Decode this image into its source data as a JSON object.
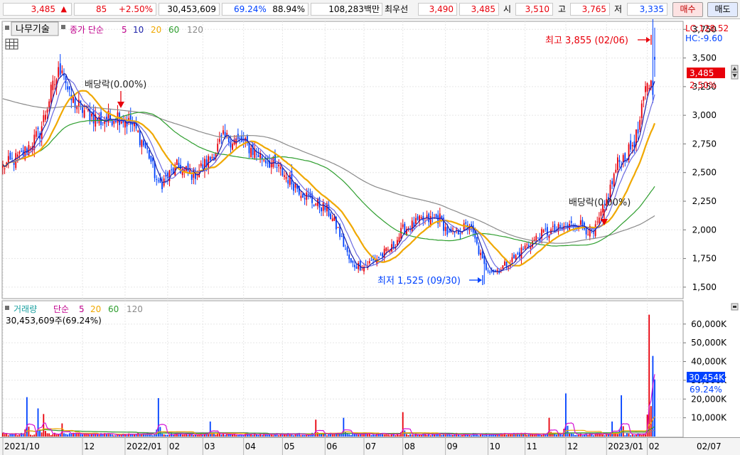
{
  "quote": {
    "price": "3,485",
    "change": "85",
    "change_pct": "+2.50%",
    "volume": "30,453,609",
    "vol_ratio": "69.24%",
    "turnover_ratio": "88.94%",
    "amount": "108,283백만",
    "best_label": "최우선",
    "ask": "3,490",
    "bid": "3,485",
    "open_label": "시",
    "open": "3,510",
    "high_label": "고",
    "high": "3,765",
    "low_label": "저",
    "low": "3,335",
    "buy_btn": "매수",
    "sell_btn": "매도"
  },
  "price_panel": {
    "tech_btn": "나무기술",
    "legend_prefix": "종가 단순",
    "ma_labels": [
      "5",
      "10",
      "20",
      "60",
      "120"
    ],
    "lc_label": "LC:128.52",
    "hc_label": "HC:-9.60",
    "last_price_label": "3,485",
    "last_change_label": "2.50%",
    "max_label": "최고 3,855 (02/06)",
    "min_label": "최저 1,525 (09/30)",
    "dividend_label": "배당락(0.00%)"
  },
  "volume_panel": {
    "legend_name": "거래량",
    "legend_prefix": "단순",
    "ma_labels": [
      "5",
      "20",
      "60",
      "120"
    ],
    "info_label": "30,453,609주(69.24%)",
    "last_volume_label": "30,454K",
    "last_pct_label": "69.24%"
  },
  "colors": {
    "up": "#e8000b",
    "down": "#0042ff",
    "ma5": "#1a1fa8",
    "ma10": "#6a6ae0",
    "ma20": "#f0a800",
    "ma60": "#2e9e2e",
    "ma120": "#8a8a8a",
    "vma5": "#d40fd4",
    "vma20": "#f0a800",
    "vma60": "#2e9e2e",
    "vma120": "#8a8a8a",
    "label_red": "#e8000b",
    "label_blue": "#0042ff",
    "grid": "#e6e6e6",
    "panel_border": "#9a9a9a"
  },
  "chart_data": {
    "type": "candlestick",
    "price_axis": {
      "min": 1400,
      "max": 3820,
      "ticks": [
        1500,
        1750,
        2000,
        2250,
        2500,
        2750,
        3000,
        3250,
        3500,
        3750
      ]
    },
    "volume_axis": {
      "min": 0,
      "max": 66000,
      "ticks": [
        10000,
        20000,
        30000,
        40000,
        50000,
        60000
      ],
      "tick_labels": [
        "10,000K",
        "20,000K",
        "30,000K",
        "40,000K",
        "50,000K",
        "60,000K"
      ]
    },
    "month_labels": [
      "2021/10",
      "12",
      "2022/01",
      "02",
      "03",
      "04",
      "05",
      "06",
      "07",
      "08",
      "09",
      "10",
      "11",
      "12",
      "2023/01",
      "02",
      "02/07"
    ],
    "month_starts": [
      "2021-10-01",
      "2021-12-01",
      "2022-01-03",
      "2022-02-03",
      "2022-03-02",
      "2022-04-01",
      "2022-05-02",
      "2022-06-02",
      "2022-07-01",
      "2022-08-01",
      "2022-09-01",
      "2022-10-04",
      "2022-11-01",
      "2022-12-01",
      "2023-01-02",
      "2023-02-01",
      "2023-02-07"
    ],
    "trend_points": [
      [
        "2021-10-01",
        2550
      ],
      [
        "2021-10-15",
        2650
      ],
      [
        "2021-10-29",
        2850
      ],
      [
        "2021-11-08",
        3200
      ],
      [
        "2021-11-16",
        3450
      ],
      [
        "2021-11-22",
        3150
      ],
      [
        "2021-12-01",
        3050
      ],
      [
        "2021-12-15",
        2950
      ],
      [
        "2021-12-28",
        3000
      ],
      [
        "2022-01-10",
        2900
      ],
      [
        "2022-01-20",
        2650
      ],
      [
        "2022-01-27",
        2380
      ],
      [
        "2022-02-10",
        2550
      ],
      [
        "2022-02-23",
        2480
      ],
      [
        "2022-03-08",
        2620
      ],
      [
        "2022-03-17",
        2800
      ],
      [
        "2022-03-31",
        2770
      ],
      [
        "2022-04-10",
        2680
      ],
      [
        "2022-04-26",
        2560
      ],
      [
        "2022-05-10",
        2400
      ],
      [
        "2022-05-24",
        2250
      ],
      [
        "2022-06-03",
        2180
      ],
      [
        "2022-06-13",
        2000
      ],
      [
        "2022-06-22",
        1700
      ],
      [
        "2022-07-01",
        1680
      ],
      [
        "2022-07-12",
        1750
      ],
      [
        "2022-07-22",
        1840
      ],
      [
        "2022-08-01",
        2000
      ],
      [
        "2022-08-15",
        2080
      ],
      [
        "2022-08-29",
        2100
      ],
      [
        "2022-09-05",
        1950
      ],
      [
        "2022-09-20",
        2040
      ],
      [
        "2022-09-30",
        1680
      ],
      [
        "2022-10-10",
        1640
      ],
      [
        "2022-10-20",
        1720
      ],
      [
        "2022-11-01",
        1850
      ],
      [
        "2022-11-15",
        1970
      ],
      [
        "2022-12-01",
        2020
      ],
      [
        "2022-12-12",
        2060
      ],
      [
        "2022-12-22",
        1960
      ],
      [
        "2023-01-02",
        2250
      ],
      [
        "2023-01-10",
        2580
      ],
      [
        "2023-01-18",
        2680
      ],
      [
        "2023-01-25",
        2850
      ],
      [
        "2023-02-01",
        3300
      ],
      [
        "2023-02-06",
        3250
      ],
      [
        "2023-02-07",
        3485
      ]
    ],
    "spike_volumes": [
      [
        "2021-10-20",
        21000
      ],
      [
        "2021-10-28",
        15000
      ],
      [
        "2021-11-02",
        12000
      ],
      [
        "2021-11-16",
        7000
      ],
      [
        "2022-01-27",
        20500
      ],
      [
        "2022-03-08",
        8000
      ],
      [
        "2022-05-26",
        9000
      ],
      [
        "2022-06-16",
        10000
      ],
      [
        "2022-08-01",
        13000
      ],
      [
        "2022-11-18",
        10000
      ],
      [
        "2022-12-01",
        23000
      ],
      [
        "2023-01-05",
        8000
      ],
      [
        "2023-01-12",
        22000
      ],
      [
        "2023-02-02",
        65000
      ],
      [
        "2023-02-06",
        43000
      ],
      [
        "2023-02-07",
        30454
      ]
    ],
    "price_ma_names": [
      "5",
      "10",
      "20",
      "60",
      "120"
    ],
    "volume_ma_names": [
      "5",
      "20",
      "60",
      "120"
    ],
    "last": {
      "date": "2023-02-07",
      "close": 3485,
      "change": 85,
      "change_pct": 2.5,
      "volume": 30453609
    },
    "max": {
      "value": 3855,
      "date": "02/06"
    },
    "min": {
      "value": 1525,
      "date": "09/30"
    },
    "dividend_marks": [
      "2021-12-28",
      "2022-12-28"
    ]
  }
}
